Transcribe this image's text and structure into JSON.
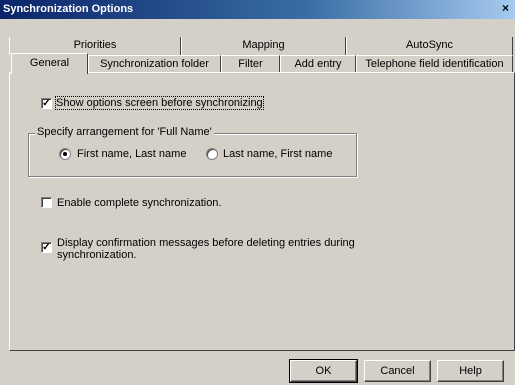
{
  "window": {
    "title": "Synchronization Options",
    "close_glyph": "×"
  },
  "tabs_back": [
    "Priorities",
    "Mapping",
    "AutoSync"
  ],
  "tabs_front": [
    "General",
    "Synchronization folder",
    "Filter",
    "Add entry",
    "Telephone field identification"
  ],
  "selected_tab": "General",
  "options": {
    "show_options": {
      "label": "Show options screen before synchronizing",
      "checked": true
    },
    "name_group": {
      "title": "Specify arrangement for 'Full Name'",
      "first_last": {
        "label": "First name, Last name",
        "selected": true
      },
      "last_first": {
        "label": "Last name, First name",
        "selected": false
      }
    },
    "complete_sync": {
      "label": "Enable complete synchronization.",
      "checked": false
    },
    "confirm_delete": {
      "label_line1": "Display confirmation messages before deleting entries during",
      "label_line2": "synchronization.",
      "checked": true
    }
  },
  "buttons": {
    "ok": "OK",
    "cancel": "Cancel",
    "help": "Help"
  },
  "check_glyph": "✓"
}
